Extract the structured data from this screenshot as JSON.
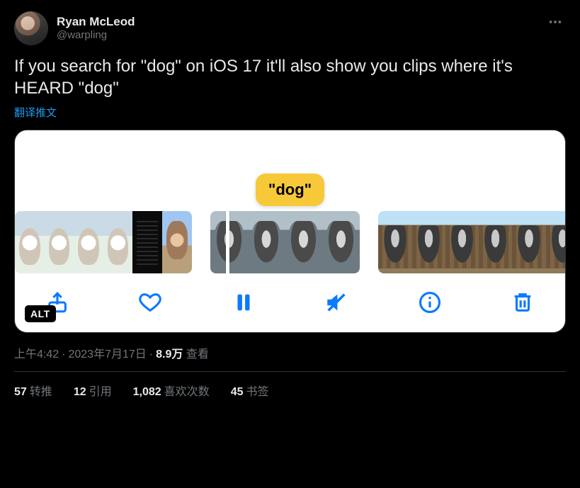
{
  "author": {
    "display_name": "Ryan McLeod",
    "handle": "@warpling"
  },
  "body_text": "If you search for \"dog\" on iOS 17 it'll also show you clips where it's HEARD \"dog\"",
  "translate_label": "翻译推文",
  "media": {
    "bubble_text": "\"dog\"",
    "alt_badge": "ALT"
  },
  "meta": {
    "time": "上午4:42",
    "date": "2023年7月17日",
    "views_number": "8.9万",
    "views_label": "查看"
  },
  "stats": {
    "retweets_count": "57",
    "retweets_label": "转推",
    "quotes_count": "12",
    "quotes_label": "引用",
    "likes_count": "1,082",
    "likes_label": "喜欢次数",
    "bookmarks_count": "45",
    "bookmarks_label": "书签"
  }
}
